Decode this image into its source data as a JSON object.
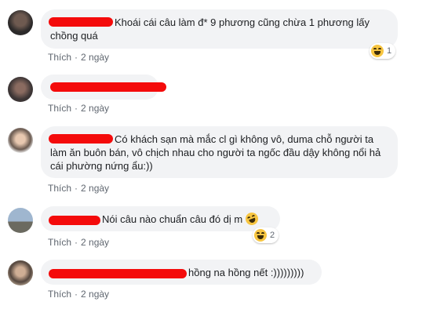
{
  "comments": [
    {
      "text": "Khoái cái câu làm đ* 9 phương cũng chừa 1 phương lấy chồng quá",
      "like": "Thích",
      "time": "2 ngày",
      "reaction": {
        "icon": "haha-reaction-icon",
        "count": "1"
      }
    },
    {
      "text": "",
      "like": "Thích",
      "time": "2 ngày"
    },
    {
      "text": "Có khách sạn mà mắc cl gì không vô, duma chỗ người ta làm ăn buôn bán, vô chịch nhau cho người ta ngốc đầu dậy không nổi hả cái phường nứng ẩu:))",
      "like": "Thích",
      "time": "2 ngày"
    },
    {
      "text": "Nói câu nào chuẩn câu đó dị m",
      "like": "Thích",
      "time": "2 ngày",
      "reaction": {
        "icon": "haha-reaction-icon",
        "count": "2"
      }
    },
    {
      "text": "hồng na hồng nết :)))))))))",
      "like": "Thích",
      "time": "2 ngày"
    }
  ],
  "colors": {
    "bubble": "#f2f3f5",
    "link": "#385898",
    "redaction": "#f40b0b",
    "meta": "#606770"
  }
}
